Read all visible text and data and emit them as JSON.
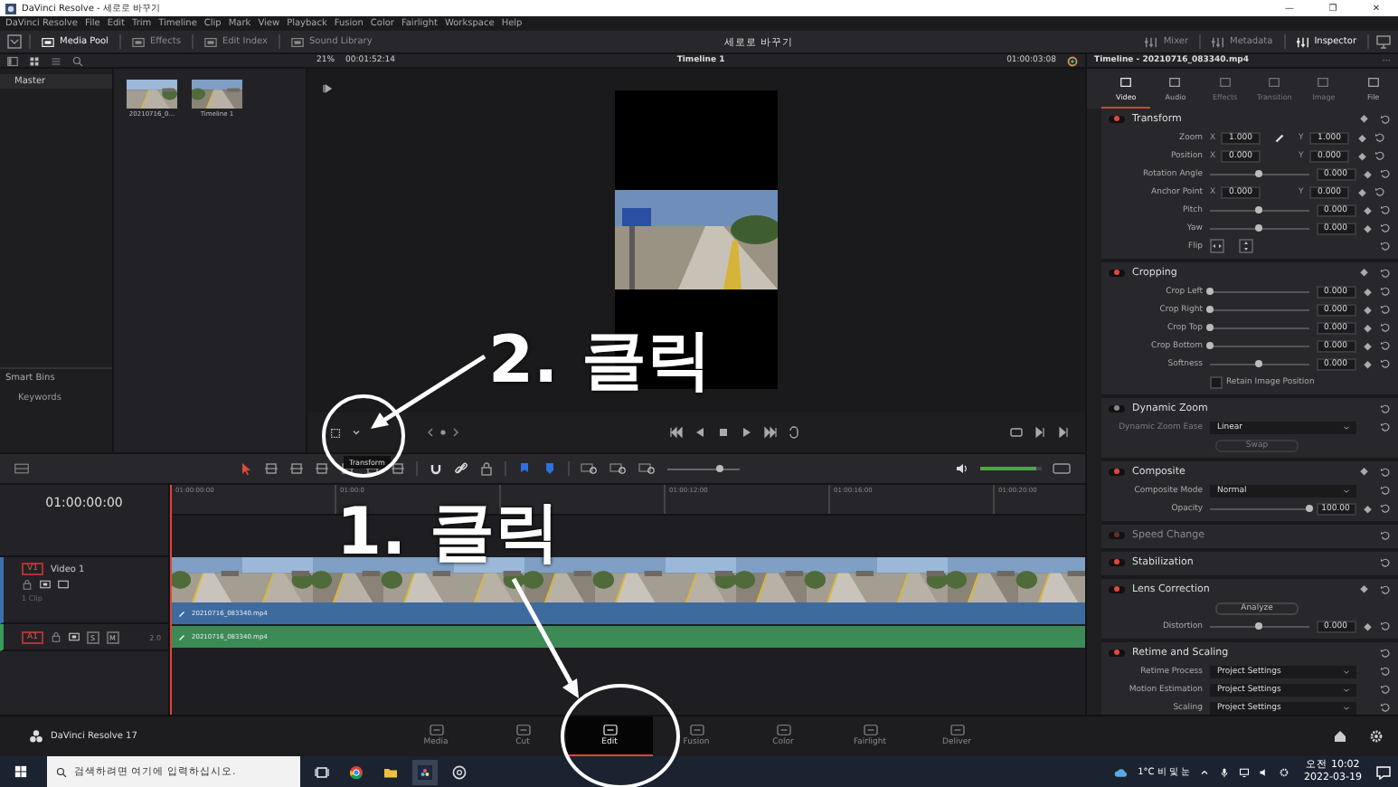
{
  "window": {
    "title": "DaVinci Resolve - 세로로 바꾸기",
    "controls": [
      "—",
      "❐",
      "✕"
    ]
  },
  "menu": [
    "DaVinci Resolve",
    "File",
    "Edit",
    "Trim",
    "Timeline",
    "Clip",
    "Mark",
    "View",
    "Playback",
    "Fusion",
    "Color",
    "Fairlight",
    "Workspace",
    "Help"
  ],
  "toolbar": {
    "left": [
      {
        "label": "Media Pool",
        "active": true
      },
      {
        "label": "Effects",
        "active": false
      },
      {
        "label": "Edit Index",
        "active": false
      },
      {
        "label": "Sound Library",
        "active": false
      }
    ],
    "project": "세로로 바꾸기",
    "right": [
      {
        "label": "Mixer",
        "active": false
      },
      {
        "label": "Metadata",
        "active": false
      },
      {
        "label": "Inspector",
        "active": true
      }
    ]
  },
  "viewer_bar": {
    "zoom": "21%",
    "duration": "00:01:52:14",
    "timeline": "Timeline 1",
    "timecode": "01:00:03:08"
  },
  "media_pool": {
    "bins": [
      "Master"
    ],
    "smart_bins": "Smart Bins",
    "keywords": "Keywords",
    "clips": [
      {
        "name": "20210716_0..."
      },
      {
        "name": "Timeline 1"
      }
    ]
  },
  "tooltip": "Transform",
  "timeline": {
    "timecode": "01:00:00:00",
    "ruler": [
      {
        "label": "01:00:00:00"
      },
      {
        "label": "01:00:0"
      },
      {
        "covered": true
      },
      {
        "label": "01:00:12:00"
      },
      {
        "label": "01:00:16:00"
      },
      {
        "label": "01:00:20:00"
      }
    ],
    "zoom_slider": {
      "level": 0.72
    },
    "volume": {
      "level": 0.92
    },
    "tracks": [
      {
        "kind": "video",
        "badge": "V1",
        "name": "Video 1",
        "info": "1 Clip",
        "clip": "20210716_083340.mp4"
      },
      {
        "kind": "audio",
        "badge": "A1",
        "solo": "S",
        "mute": "M",
        "channels": "2.0",
        "clip": "20210716_083340.mp4"
      }
    ]
  },
  "inspector": {
    "title": "Timeline - 20210716_083340.mp4",
    "more": "···",
    "tabs": [
      {
        "label": "Video",
        "selected": true,
        "disabled": false
      },
      {
        "label": "Audio",
        "selected": false,
        "disabled": false
      },
      {
        "label": "Effects",
        "selected": false,
        "disabled": true
      },
      {
        "label": "Transition",
        "selected": false,
        "disabled": true
      },
      {
        "label": "Image",
        "selected": false,
        "disabled": true
      },
      {
        "label": "File",
        "selected": false,
        "disabled": false
      }
    ],
    "sections": [
      {
        "title": "Transform",
        "enabled": true,
        "disabled": false,
        "keyframe": true,
        "rows": [
          {
            "kind": "xy",
            "label": "Zoom",
            "x": {
              "axis": "X",
              "value": "1.000"
            },
            "y": {
              "axis": "Y",
              "value": "1.000"
            },
            "linked": true,
            "keyframe": true
          },
          {
            "kind": "xy",
            "label": "Position",
            "x": {
              "axis": "X",
              "value": "0.000"
            },
            "y": {
              "axis": "Y",
              "value": "0.000"
            },
            "linked": false,
            "keyframe": true
          },
          {
            "kind": "slider",
            "label": "Rotation Angle",
            "level": 0.5,
            "value": "0.000",
            "keyframe": true
          },
          {
            "kind": "xy",
            "label": "Anchor Point",
            "x": {
              "axis": "X",
              "value": "0.000"
            },
            "y": {
              "axis": "Y",
              "value": "0.000"
            },
            "linked": false,
            "keyframe": true
          },
          {
            "kind": "slider",
            "label": "Pitch",
            "level": 0.5,
            "value": "0.000",
            "keyframe": true
          },
          {
            "kind": "slider",
            "label": "Yaw",
            "level": 0.5,
            "value": "0.000",
            "keyframe": true
          },
          {
            "kind": "flip",
            "label": "Flip",
            "keyframe": false
          }
        ]
      },
      {
        "title": "Cropping",
        "enabled": true,
        "disabled": false,
        "keyframe": true,
        "rows": [
          {
            "kind": "slider",
            "label": "Crop Left",
            "level": 0,
            "value": "0.000",
            "keyframe": true
          },
          {
            "kind": "slider",
            "label": "Crop Right",
            "level": 0,
            "value": "0.000",
            "keyframe": true
          },
          {
            "kind": "slider",
            "label": "Crop Top",
            "level": 0,
            "value": "0.000",
            "keyframe": true
          },
          {
            "kind": "slider",
            "label": "Crop Bottom",
            "level": 0,
            "value": "0.000",
            "keyframe": true
          },
          {
            "kind": "slider",
            "label": "Softness",
            "level": 0.5,
            "value": "0.000",
            "keyframe": true
          },
          {
            "kind": "check",
            "label": "Retain Image Position",
            "checked": false,
            "keyframe": false
          }
        ]
      },
      {
        "title": "Dynamic Zoom",
        "enabled": false,
        "disabled": false,
        "keyframe": false,
        "rows": [
          {
            "kind": "select",
            "label": "Dynamic Zoom Ease",
            "value": "Linear",
            "disabled": true,
            "keyframe": false
          },
          {
            "kind": "button",
            "label": "Swap",
            "disabled": true,
            "keyframe": false
          }
        ]
      },
      {
        "title": "Composite",
        "enabled": true,
        "disabled": false,
        "keyframe": true,
        "rows": [
          {
            "kind": "select",
            "label": "Composite Mode",
            "value": "Normal",
            "disabled": false,
            "keyframe": false
          },
          {
            "kind": "slider",
            "label": "Opacity",
            "level": 1,
            "value": "100.00",
            "keyframe": true
          }
        ]
      },
      {
        "title": "Speed Change",
        "enabled": true,
        "disabled": true,
        "keyframe": false
      },
      {
        "title": "Stabilization",
        "enabled": true,
        "disabled": false,
        "keyframe": false
      },
      {
        "title": "Lens Correction",
        "enabled": true,
        "disabled": false,
        "keyframe": true,
        "rows": [
          {
            "kind": "button",
            "label": "Analyze",
            "disabled": false,
            "keyframe": false
          },
          {
            "kind": "slider",
            "label": "Distortion",
            "level": 0.5,
            "value": "0.000",
            "keyframe": true
          }
        ]
      },
      {
        "title": "Retime and Scaling",
        "enabled": true,
        "disabled": false,
        "keyframe": false,
        "rows": [
          {
            "kind": "select",
            "label": "Retime Process",
            "value": "Project Settings",
            "disabled": false,
            "keyframe": false
          },
          {
            "kind": "select",
            "label": "Motion Estimation",
            "value": "Project Settings",
            "disabled": false,
            "keyframe": false
          },
          {
            "kind": "select",
            "label": "Scaling",
            "value": "Project Settings",
            "disabled": false,
            "keyframe": false
          }
        ]
      }
    ]
  },
  "app_name": "DaVinci Resolve 17",
  "pages": [
    {
      "label": "Media",
      "selected": false
    },
    {
      "label": "Cut",
      "selected": false
    },
    {
      "label": "Edit",
      "selected": true
    },
    {
      "label": "Fusion",
      "selected": false
    },
    {
      "label": "Color",
      "selected": false
    },
    {
      "label": "Fairlight",
      "selected": false
    },
    {
      "label": "Deliver",
      "selected": false
    }
  ],
  "annotations": [
    {
      "text": "2. 클릭"
    },
    {
      "text": "1. 클릭"
    }
  ],
  "taskbar": {
    "search_placeholder": "검색하려면 여기에 입력하십시오.",
    "weather": "1°C 비 및 눈",
    "time": "오전 10:02",
    "date": "2022-03-19"
  }
}
